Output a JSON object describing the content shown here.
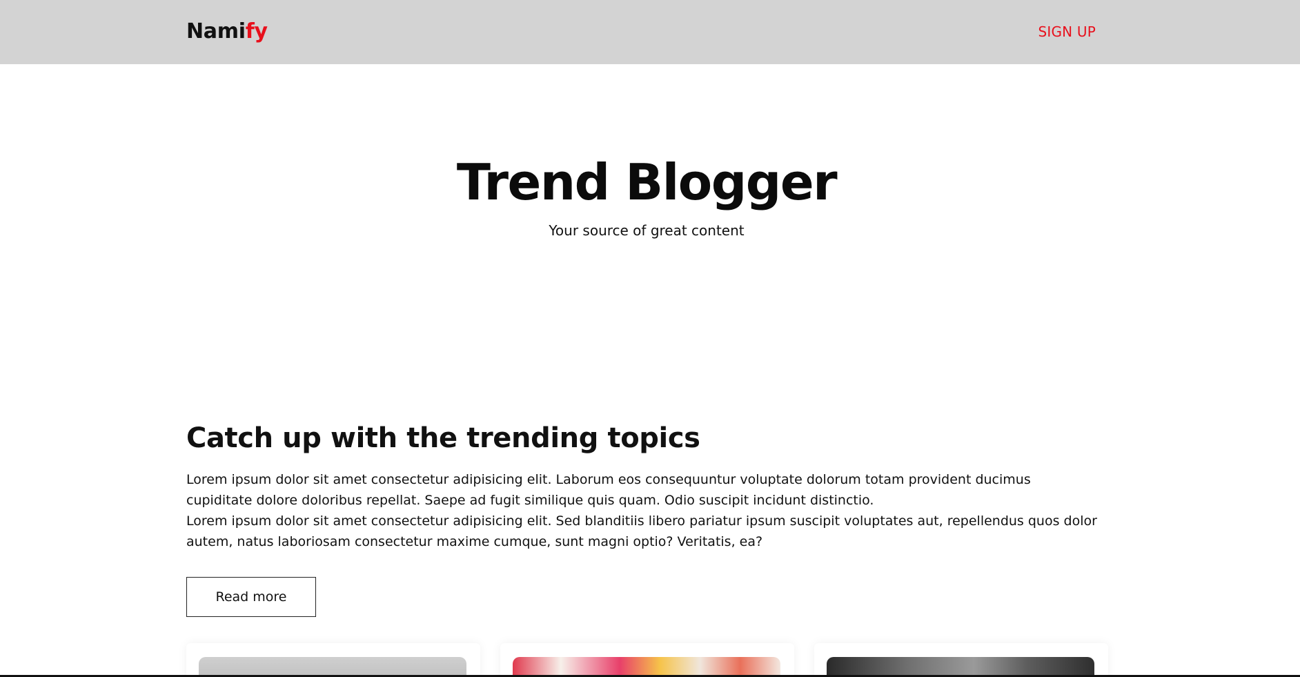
{
  "navbar": {
    "brand_main": "Nami",
    "brand_accent": "fy",
    "signup_label": "SIGN UP"
  },
  "hero": {
    "title": "Trend Blogger",
    "subtitle": "Your source of great content"
  },
  "section": {
    "title": "Catch up with the trending topics",
    "paragraph_1": "Lorem ipsum dolor sit amet consectetur adipisicing elit. Laborum eos consequuntur voluptate dolorum totam provident ducimus cupiditate dolore doloribus repellat. Saepe ad fugit similique quis quam. Odio suscipit incidunt distinctio.",
    "paragraph_2": "Lorem ipsum dolor sit amet consectetur adipisicing elit. Sed blanditiis libero pariatur ipsum suscipit voluptates aut, repellendus quos dolor autem, natus laboriosam consectetur maxime cumque, sunt magni optio? Veritatis, ea?",
    "read_more_label": "Read more"
  },
  "colors": {
    "accent": "#e8101c",
    "navbar_bg": "#d3d3d3"
  }
}
